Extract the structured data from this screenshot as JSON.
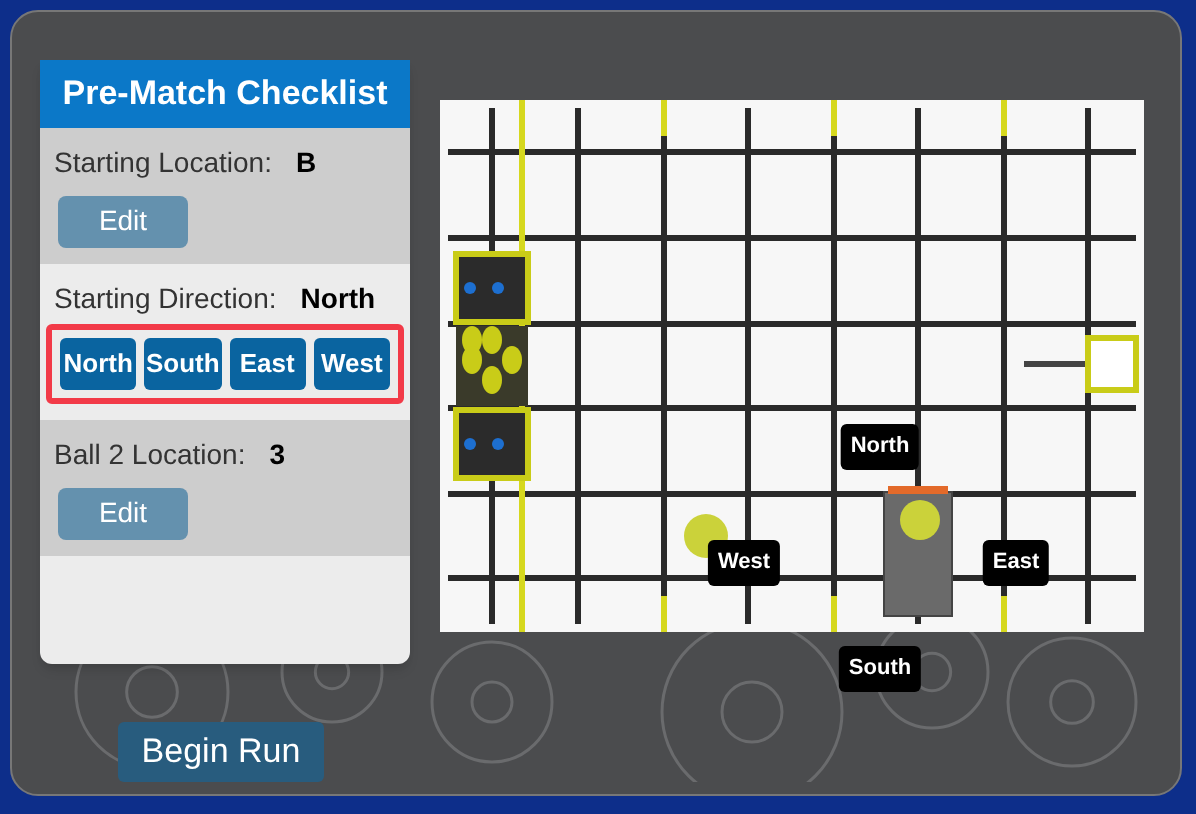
{
  "checklist": {
    "title": "Pre-Match Checklist",
    "items": [
      {
        "kind": "edit",
        "label": "Starting Location:",
        "value": "B",
        "button": "Edit",
        "active": false
      },
      {
        "kind": "choice",
        "label": "Starting Direction:",
        "value": "North",
        "active": true,
        "highlighted": true,
        "options": [
          "North",
          "South",
          "East",
          "West"
        ]
      },
      {
        "kind": "edit",
        "label": "Ball 2 Location:",
        "value": "3",
        "button": "Edit",
        "active": false
      }
    ]
  },
  "field": {
    "direction_labels": [
      "North",
      "West",
      "East",
      "South"
    ]
  },
  "begin_button": "Begin Run"
}
